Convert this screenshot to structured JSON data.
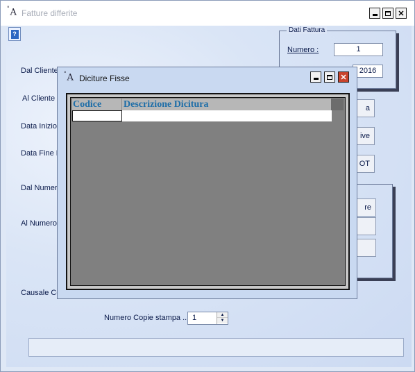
{
  "main_window": {
    "icon_glyph": "A",
    "icon_mark": "°",
    "title": "Fatture differite",
    "controls": {
      "minimize": "",
      "maximize": "",
      "close": "✕"
    }
  },
  "form": {
    "help_glyph": "?",
    "labels": {
      "dal_cliente": "Dal Cliente",
      "al_cliente": "Al Cliente",
      "data_inizio": "Data Inizio",
      "data_fine": "Data Fine F",
      "dal_numero": "Dal Numero",
      "al_numero": "Al Numero",
      "causale": "Causale Co"
    },
    "dati_fattura": {
      "caption": "Dati Fattura",
      "numero_label": "Numero :",
      "numero_value": "1",
      "data_value": "2016"
    },
    "side_buttons": [
      "a",
      "ive",
      "OT"
    ],
    "second_group_buttons": [
      "re",
      "",
      ""
    ],
    "copies": {
      "label": "Numero Copie stampa ..:",
      "value": "1"
    }
  },
  "dialog": {
    "icon_glyph": "A",
    "icon_mark": "°",
    "title": "Diciture Fisse",
    "controls": {
      "minimize": "",
      "maximize": "",
      "close": "✕"
    },
    "grid": {
      "columns": [
        "Codice",
        "Descrizione Dicitura"
      ],
      "rows": [
        [
          "",
          ""
        ]
      ]
    }
  },
  "colors": {
    "client_bg": "#dae5f6",
    "dialog_bg": "#c9d9f1",
    "grid_bg": "#808080",
    "header_text": "#1e6ea8",
    "close_red": "#c9432b"
  }
}
